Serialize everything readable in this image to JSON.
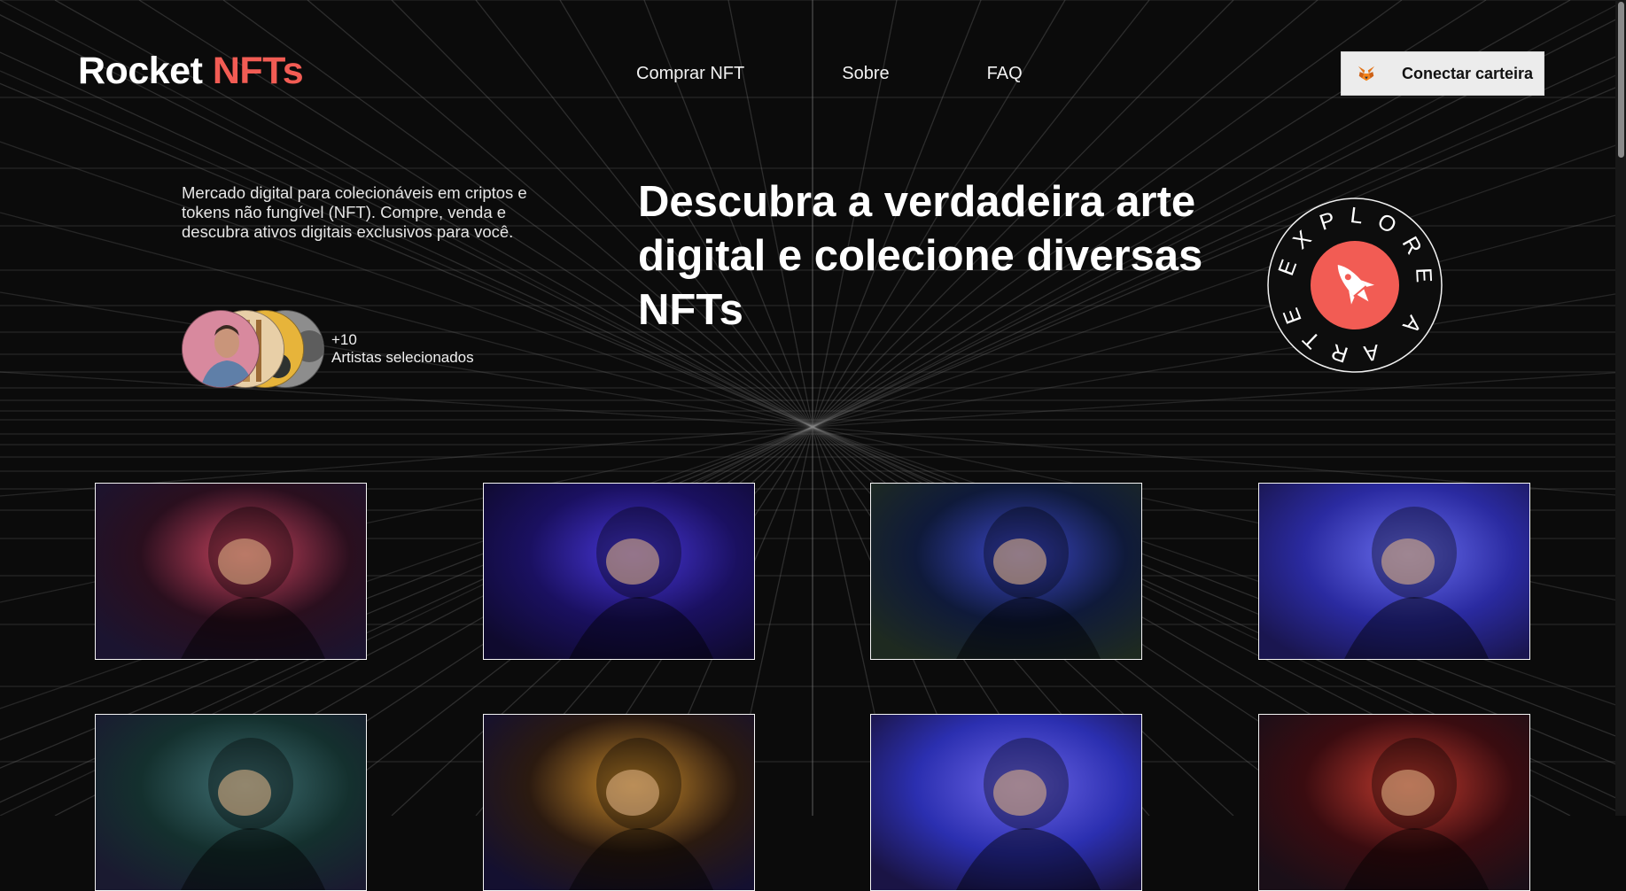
{
  "brand": {
    "name": "Rocket",
    "accent_word": "NFTs",
    "accent_color": "#f25c54"
  },
  "nav": {
    "items": [
      {
        "label": "Comprar NFT"
      },
      {
        "label": "Sobre"
      },
      {
        "label": "FAQ"
      }
    ]
  },
  "wallet": {
    "label": "Conectar carteira",
    "icon": "metamask-fox-icon"
  },
  "hero": {
    "description": "Mercado digital para colecionáveis em criptos e tokens não fungível (NFT). Compre, venda e descubra ativos digitais exclusivos para você.",
    "title": "Descubra a verdadeira arte digital e colecione diversas NFTs",
    "artists_count": "+10",
    "artists_label": "Artistas selecionados"
  },
  "badge": {
    "ring_text": "EXPLORE A ARTE",
    "icon": "rocket-icon",
    "color": "#f25c54"
  },
  "gallery": {
    "items": [
      {
        "alt": "astronaut-red-light",
        "tone": [
          "#2a0f1e",
          "#c9435e",
          "#1b1430"
        ]
      },
      {
        "alt": "astronaut-purple-haze",
        "tone": [
          "#1a1060",
          "#4736d9",
          "#0f0a2e"
        ]
      },
      {
        "alt": "astronaut-green-corridor",
        "tone": [
          "#0f1a3a",
          "#3b46c9",
          "#1e2a20"
        ]
      },
      {
        "alt": "astronaut-blue-bokeh",
        "tone": [
          "#2a2aa0",
          "#6a6ef0",
          "#1a1650"
        ]
      },
      {
        "alt": "astronaut-teal-helmet",
        "tone": [
          "#14302e",
          "#3f6f73",
          "#1a1a30"
        ]
      },
      {
        "alt": "astronaut-golden-light",
        "tone": [
          "#2b1a10",
          "#c98a2a",
          "#141030"
        ]
      },
      {
        "alt": "astronaut-blue-bokeh-2",
        "tone": [
          "#2b2fb0",
          "#6d66e8",
          "#1a1445"
        ]
      },
      {
        "alt": "astronaut-red-room",
        "tone": [
          "#3a0c10",
          "#c23a2e",
          "#1a0f18"
        ]
      }
    ]
  }
}
